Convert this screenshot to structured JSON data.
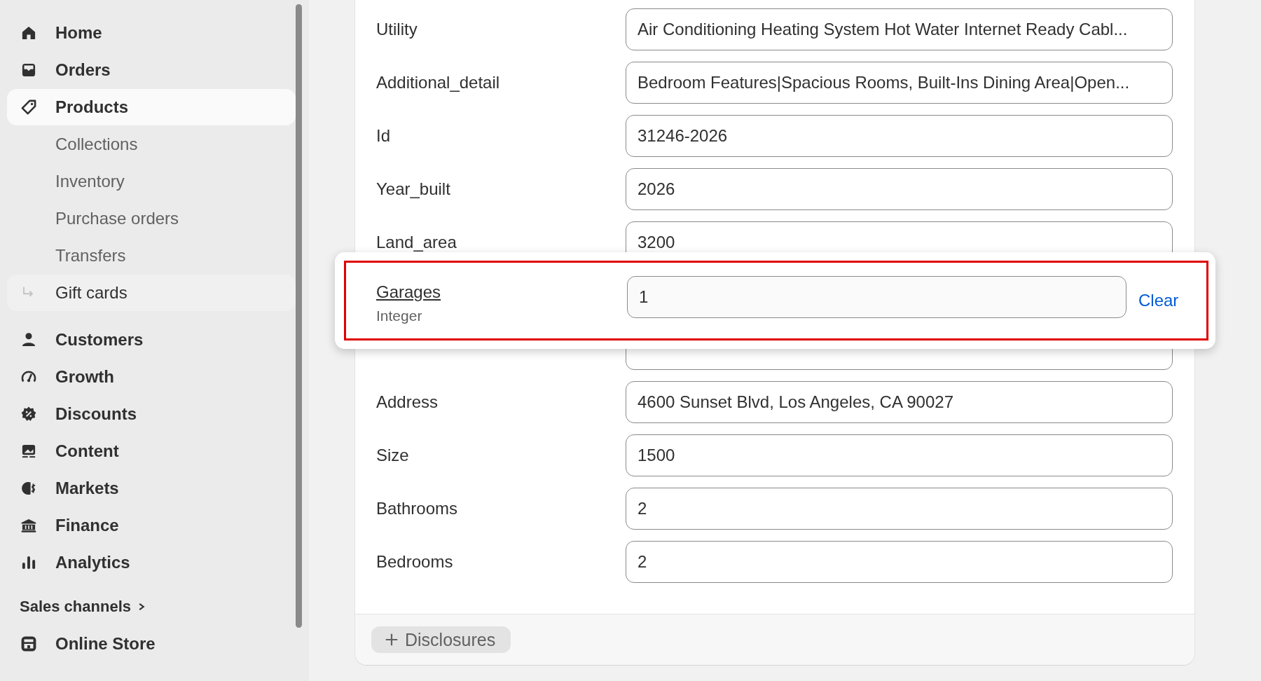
{
  "sidebar": {
    "items": [
      {
        "label": "Home",
        "selected": false
      },
      {
        "label": "Orders",
        "selected": false
      },
      {
        "label": "Products",
        "selected": true,
        "children": [
          {
            "label": "Collections",
            "hovered": false
          },
          {
            "label": "Inventory",
            "hovered": false
          },
          {
            "label": "Purchase orders",
            "hovered": false
          },
          {
            "label": "Transfers",
            "hovered": false
          },
          {
            "label": "Gift cards",
            "hovered": true
          }
        ]
      },
      {
        "label": "Customers",
        "selected": false
      },
      {
        "label": "Growth",
        "selected": false
      },
      {
        "label": "Discounts",
        "selected": false
      },
      {
        "label": "Content",
        "selected": false
      },
      {
        "label": "Markets",
        "selected": false
      },
      {
        "label": "Finance",
        "selected": false
      },
      {
        "label": "Analytics",
        "selected": false
      }
    ],
    "section_title": "Sales channels",
    "channels": [
      {
        "label": "Online Store",
        "selected": false
      }
    ]
  },
  "form": {
    "fields": [
      {
        "label": "Utility",
        "value": "Air Conditioning Heating System Hot Water Internet Ready Cabl..."
      },
      {
        "label": "Additional_detail",
        "value": "Bedroom Features|Spacious Rooms, Built-Ins Dining Area|Open..."
      },
      {
        "label": "Id",
        "value": "31246-2026"
      },
      {
        "label": "Year_built",
        "value": "2026"
      },
      {
        "label": "Land_area",
        "value": "3200"
      },
      {
        "label": "Address",
        "value": "4600 Sunset Blvd, Los Angeles, CA 90027"
      },
      {
        "label": "Size",
        "value": "1500"
      },
      {
        "label": "Bathrooms",
        "value": "2"
      },
      {
        "label": "Bedrooms",
        "value": "2"
      }
    ],
    "footer_button": "Disclosures"
  },
  "popup": {
    "label": "Garages",
    "type": "Integer",
    "value": "1",
    "action": "Clear",
    "highlighted": true
  }
}
